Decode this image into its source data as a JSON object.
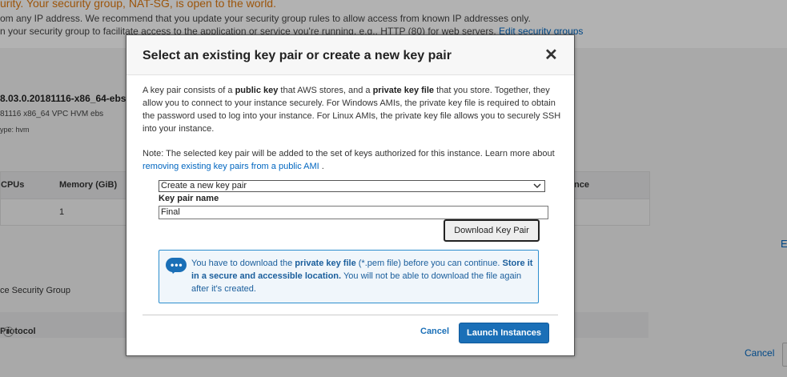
{
  "background": {
    "warning_title": "urity. Your security group, NAT-SG, is open to the world.",
    "warning_line1": "om any IP address. We recommend that you update your security group rules to allow access from known IP addresses only.",
    "warning_line2": "n your security group to facilitate access to the application or service you're running, e.g., HTTP (80) for web servers.",
    "warning_link": "Edit security groups",
    "ami_name": "8.03.0.20181116-x86_64-ebs",
    "ami_sub": "81116 x86_64 VPC HVM ebs",
    "ami_sub2": "ype: hvm",
    "table": {
      "headers": [
        "CPUs",
        "Memory (GiB)",
        "nce"
      ],
      "row": [
        "",
        "1",
        ""
      ]
    },
    "security_group_text": "ce Security Group",
    "protocol_header": "Protocol",
    "info_symbol": "i",
    "right_edge_link": "E",
    "cancel_label": "Cancel"
  },
  "modal": {
    "title": "Select an existing key pair or create a new key pair",
    "close_symbol": "✕",
    "intro_parts": [
      "A key pair consists of a ",
      "public key",
      " that AWS stores, and a ",
      "private key file",
      " that you store. Together, they allow you to connect to your instance securely. For Windows AMIs, the private key file is required to obtain the password used to log into your instance. For Linux AMIs, the private key file allows you to securely SSH into your instance."
    ],
    "note_text": "Note: The selected key pair will be added to the set of keys authorized for this instance. Learn more about ",
    "note_link": "removing existing key pairs from a public AMI",
    "note_end": " .",
    "key_pair_option": "Create a new key pair",
    "key_pair_name_label": "Key pair name",
    "key_pair_name_value": "Final",
    "download_button": "Download Key Pair",
    "alert_parts": [
      "You have to download the ",
      "private key file",
      " (*.pem file) before you can continue. ",
      "Store it in a secure and accessible location.",
      " You will not be able to download the file again after it's created."
    ],
    "chat_icon_dots": "•••",
    "cancel_label": "Cancel",
    "launch_label": "Launch Instances"
  },
  "colors": {
    "primary_button": "#1a6fb7",
    "link": "#0066c0",
    "warning": "#e07a10",
    "alert_border": "#2e8ece"
  }
}
